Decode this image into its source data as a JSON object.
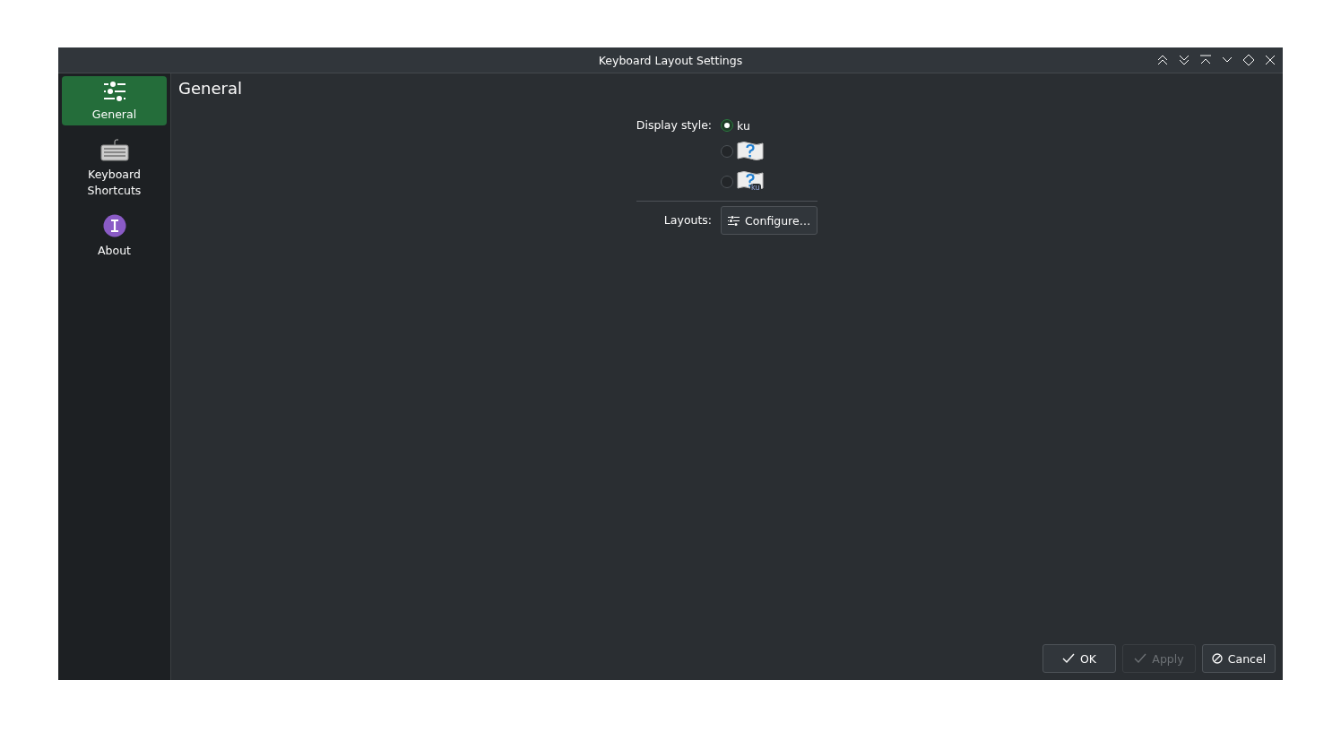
{
  "window": {
    "title": "Keyboard Layout Settings"
  },
  "sidebar": {
    "items": [
      {
        "label": "General",
        "selected": true
      },
      {
        "label": "Keyboard Shortcuts",
        "selected": false
      },
      {
        "label": "About",
        "selected": false
      }
    ]
  },
  "page": {
    "heading": "General",
    "display_style": {
      "label": "Display style:",
      "options": [
        {
          "kind": "text",
          "label": "ku",
          "selected": true
        },
        {
          "kind": "flag",
          "selected": false
        },
        {
          "kind": "flag_label",
          "badge": "ku",
          "selected": false
        }
      ]
    },
    "layouts": {
      "label": "Layouts:",
      "button": "Configure…"
    }
  },
  "buttons": [
    {
      "label": "OK",
      "disabled": false
    },
    {
      "label": "Apply",
      "disabled": true
    },
    {
      "label": "Cancel",
      "disabled": false
    }
  ]
}
